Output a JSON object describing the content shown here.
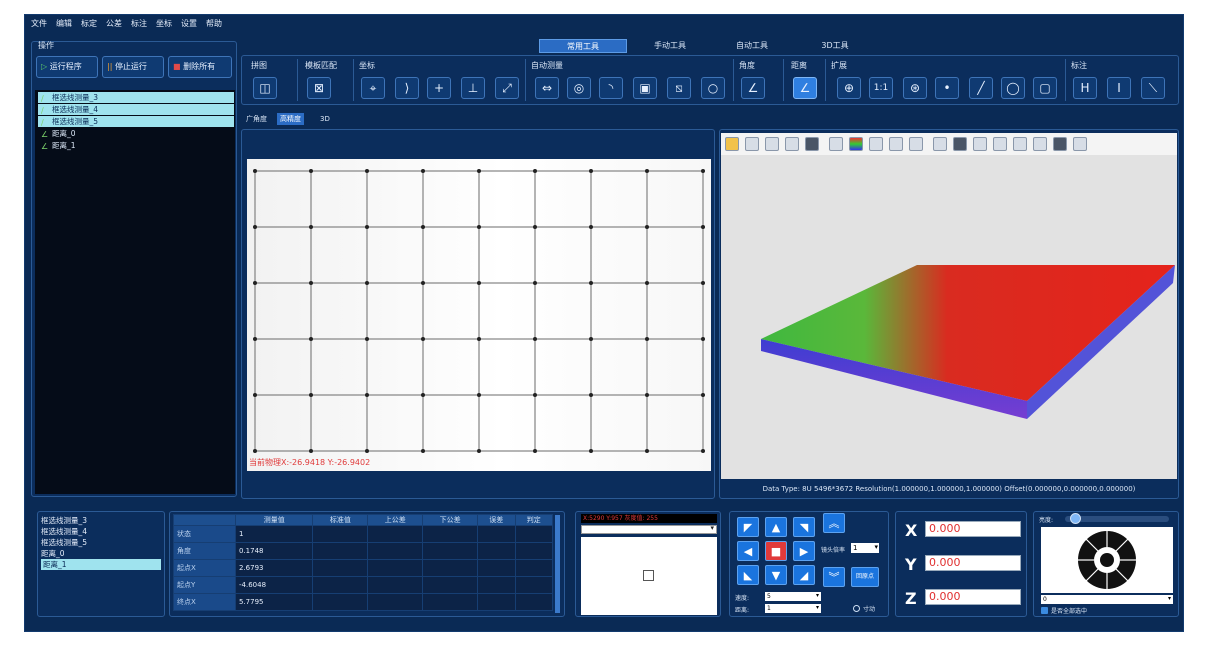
{
  "menu": [
    "文件",
    "编辑",
    "标定",
    "公差",
    "标注",
    "坐标",
    "设置",
    "帮助"
  ],
  "tabs": [
    {
      "label": "常用工具",
      "active": true
    },
    {
      "label": "手动工具",
      "active": false
    },
    {
      "label": "自动工具",
      "active": false
    },
    {
      "label": "3D工具",
      "active": false
    }
  ],
  "ops": {
    "title": "操作",
    "run_label": "运行程序",
    "stop_label": "停止运行",
    "delete_label": "删除所有"
  },
  "tree_items": [
    {
      "label": "框选线测量_3",
      "style": "hl"
    },
    {
      "label": "框选线测量_4",
      "style": "hl"
    },
    {
      "label": "框选线测量_5",
      "style": "hl"
    },
    {
      "label": "距离_0",
      "style": "dk"
    },
    {
      "label": "距离_1",
      "style": "dk"
    }
  ],
  "toolbar_groups": {
    "stitch": "拼图",
    "template": "模板匹配",
    "coord": "坐标",
    "auto_measure": "自动测量",
    "angle": "角度",
    "distance": "距离",
    "extend": "扩展",
    "annotate": "标注"
  },
  "icons": {
    "stitch": "split-icon",
    "template": "template-match-icon",
    "coord": [
      "coord-origin-icon",
      "coord-angle-icon",
      "coord-cross-icon",
      "coord-axis-icon",
      "coord-rotate-icon"
    ],
    "auto": [
      "width-measure-icon",
      "circle-measure-icon",
      "arc-measure-icon",
      "rect-measure-icon",
      "diagonal-measure-icon",
      "ring-measure-icon"
    ],
    "angle": "angle-icon",
    "distance": "distance-icon",
    "extend": [
      "crosshair-icon",
      "scale-1to1-icon",
      "target-icon",
      "point-icon",
      "line-icon",
      "circle-icon",
      "frame-icon"
    ],
    "annotate": [
      "h-dim-icon",
      "v-dim-icon",
      "slant-dim-icon"
    ]
  },
  "extend_1to1": "1:1",
  "view_tabs": [
    {
      "label": "广角度",
      "active": false
    },
    {
      "label": "高精度",
      "active": true
    },
    {
      "label": "3D",
      "active": false
    }
  ],
  "camera_overlay": "当前物理X:-26.9418  Y:-26.9402",
  "data_type": "Data Type: 8U 5496*3672 Resolution(1.000000,1.000000,1.000000) Offset(0.000000,0.000000,0.000000)",
  "list2": [
    {
      "label": "框选线测量_3",
      "selected": false
    },
    {
      "label": "框选线测量_4",
      "selected": false
    },
    {
      "label": "框选线测量_5",
      "selected": false
    },
    {
      "label": "距离_0",
      "selected": false
    },
    {
      "label": "距离_1",
      "selected": true
    }
  ],
  "table": {
    "headers": [
      "",
      "测量值",
      "标准值",
      "上公差",
      "下公差",
      "误差",
      "判定"
    ],
    "rows": [
      [
        "状态",
        "1",
        "",
        "",
        "",
        "",
        ""
      ],
      [
        "角度",
        "0.1748",
        "",
        "",
        "",
        "",
        ""
      ],
      [
        "起点X",
        "2.6793",
        "",
        "",
        "",
        "",
        ""
      ],
      [
        "起点Y",
        "-4.6048",
        "",
        "",
        "",
        "",
        ""
      ],
      [
        "终点X",
        "5.7795",
        "",
        "",
        "",
        "",
        ""
      ]
    ]
  },
  "pixel_info": "X:5290  Y:957  灰度值: 255",
  "motion": {
    "lens_label": "镜头倍率",
    "lens_value": "1",
    "speed_label": "速度:",
    "speed_value": "5",
    "dist_label": "距离:",
    "dist_value": "1",
    "inch_label": "寸动",
    "return_label": "回原点"
  },
  "xyz": {
    "x_label": "X",
    "x": "0.000",
    "y_label": "Y",
    "y": "0.000",
    "z_label": "Z",
    "z": "0.000"
  },
  "light": {
    "brightness_label": "亮度:",
    "brightness_value": 0.05,
    "select_value": "0",
    "checkbox_label": "是否全部选中"
  },
  "colors": {
    "accent": "#2f7fe0",
    "background": "#0a2a55",
    "highlight": "#9fe3ee"
  }
}
